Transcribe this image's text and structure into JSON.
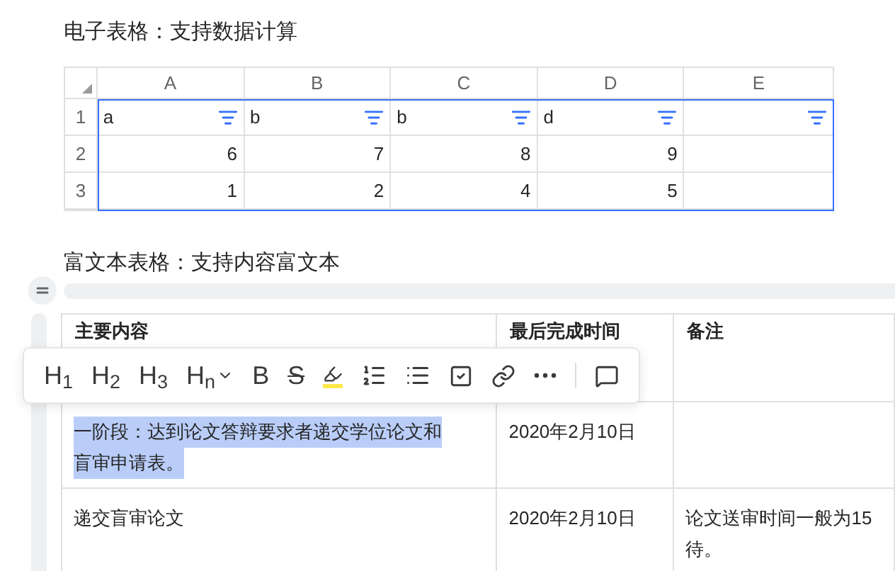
{
  "sheet_section": {
    "title": "电子表格：支持数据计算",
    "columns": [
      "A",
      "B",
      "C",
      "D",
      "E"
    ],
    "rows": [
      {
        "label": "1",
        "filter": true,
        "cells": [
          "a",
          "b",
          "b",
          "d",
          ""
        ]
      },
      {
        "label": "2",
        "filter": false,
        "cells": [
          "6",
          "7",
          "8",
          "9",
          ""
        ]
      },
      {
        "label": "3",
        "filter": false,
        "cells": [
          "1",
          "2",
          "4",
          "5",
          ""
        ]
      }
    ]
  },
  "rich_section": {
    "title": "富文本表格：支持内容富文本",
    "columns": [
      "主要内容",
      "最后完成时间",
      "备注"
    ],
    "rows": [
      {
        "cells": [
          {
            "lines": [
              "一阶段：达到论文答辩要求者递交学位论文和",
              "盲审申请表。"
            ],
            "selected": true
          },
          {
            "lines": [
              "2020年2月10日"
            ],
            "selected": false
          },
          {
            "selected": false
          }
        ]
      },
      {
        "cells": [
          {
            "lines": [
              "递交盲审论文"
            ],
            "selected": false
          },
          {
            "lines": [
              "2020年2月10日"
            ],
            "selected": false
          },
          {
            "lines": [
              "论文送审时间一般为15",
              "待。"
            ],
            "selected": false
          }
        ]
      }
    ]
  },
  "toolbar": [
    {
      "kind": "heading",
      "label": "H$_{1}$"
    },
    {
      "kind": "heading",
      "label": "H$_{2}$"
    },
    {
      "kind": "heading",
      "label": "H$_{3}$"
    },
    {
      "kind": "heading_menu",
      "label": "H$_{n}$"
    },
    {
      "kind": "bold",
      "label": "B"
    },
    {
      "kind": "strike",
      "label": "S"
    },
    {
      "kind": "highlight"
    },
    {
      "kind": "ordered_list"
    },
    {
      "kind": "bullet_list"
    },
    {
      "kind": "task"
    },
    {
      "kind": "link"
    },
    {
      "kind": "more"
    },
    {
      "kind": "divider"
    },
    {
      "kind": "comment"
    }
  ]
}
